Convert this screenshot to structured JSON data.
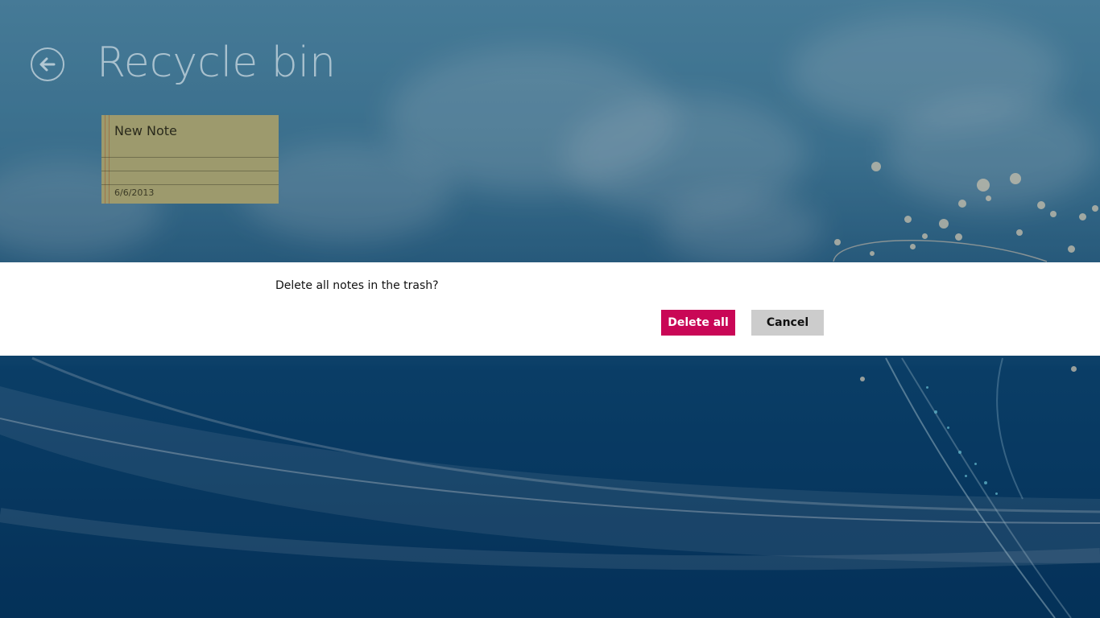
{
  "header": {
    "title": "Recycle bin",
    "back_icon": "arrow-left-circle-icon"
  },
  "notes": [
    {
      "title": "New Note",
      "date": "6/6/2013"
    }
  ],
  "dialog": {
    "message": "Delete all notes in the trash?",
    "primary_label": "Delete all",
    "secondary_label": "Cancel"
  },
  "colors": {
    "accent": "#c90756",
    "note_bg": "#9d9a6d",
    "dialog_bg": "#ffffff",
    "cancel_bg": "#cccccc"
  }
}
